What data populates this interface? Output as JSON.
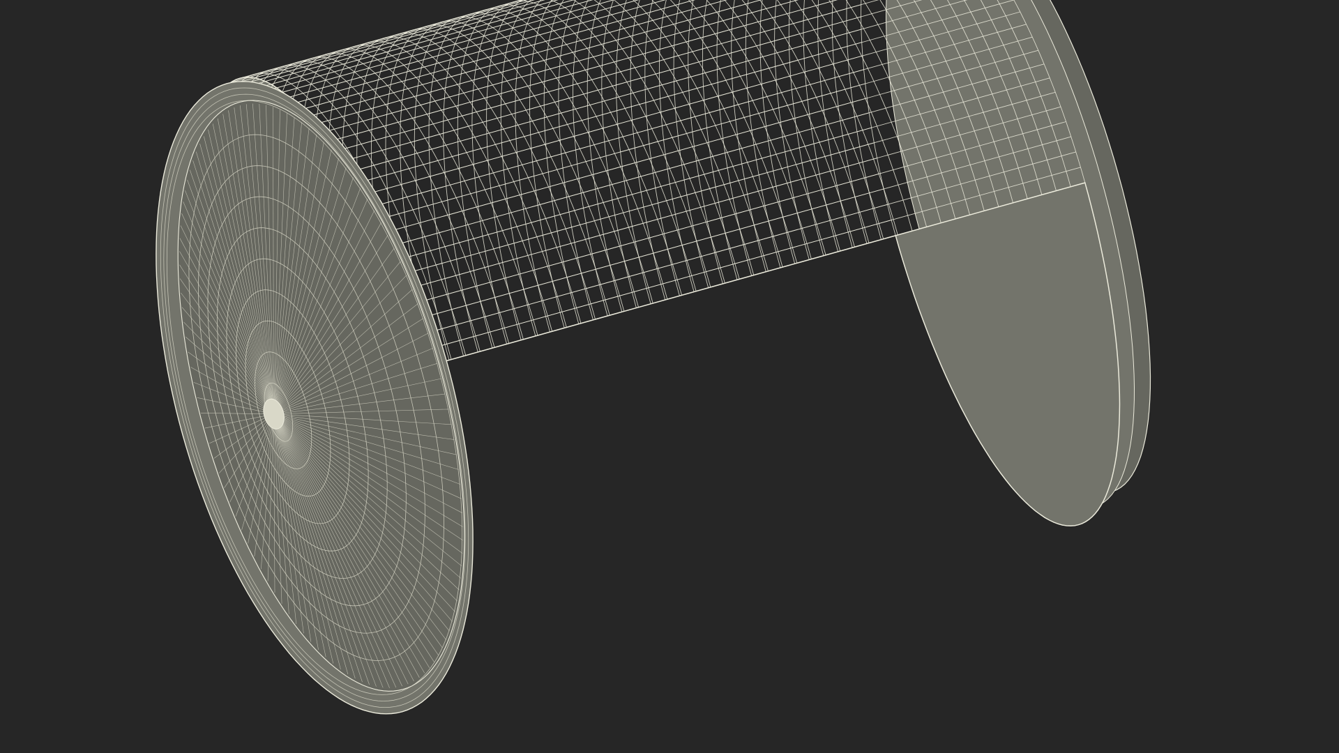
{
  "scene": {
    "subject": "wireframe-can",
    "colors": {
      "background": "#262626",
      "surface": "#73746b",
      "surface_dark": "#66675f",
      "wire": "#ecebdc",
      "wire_faint": "#d9d8c8"
    },
    "mesh": {
      "body_rings": 46,
      "body_meridians": 64,
      "bottom_spokes": 120,
      "bottom_rings": 9
    }
  }
}
